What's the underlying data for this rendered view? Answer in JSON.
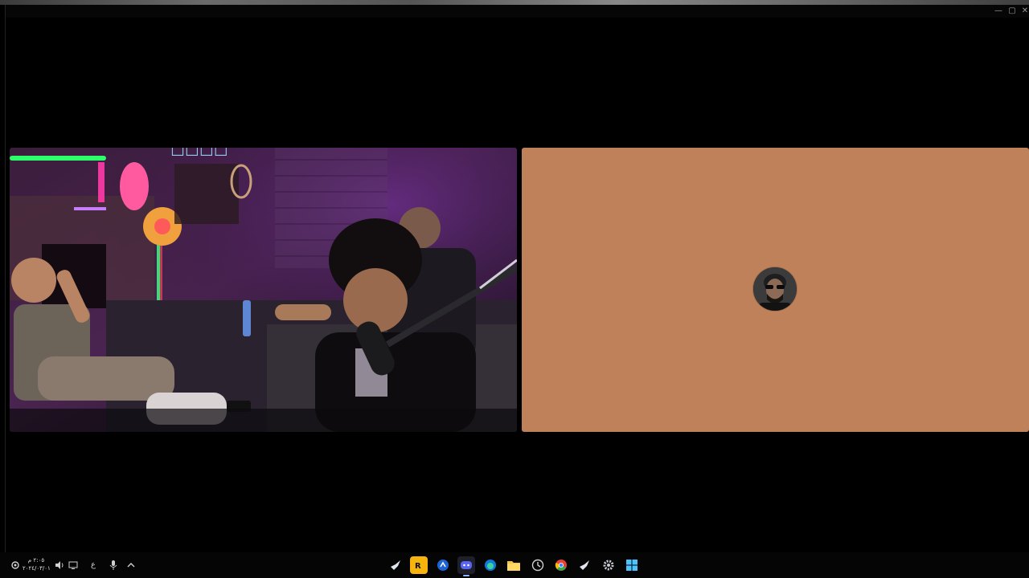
{
  "window": {
    "controls": {
      "minimize": "—",
      "maximize": "▢",
      "close": "✕"
    }
  },
  "participants": [
    {
      "type": "video"
    },
    {
      "type": "avatar",
      "tile_color": "#bf8159"
    }
  ],
  "taskbar": {
    "tray": {
      "keyboard_lang": "ع",
      "time": "٢:٠٥ م",
      "date": "٢٠٢٤/٠٣/٠١"
    },
    "apps": [
      "steam",
      "rockstar-launcher",
      "bing-visual-search",
      "discord",
      "edge",
      "file-explorer",
      "clock",
      "chrome",
      "steam",
      "settings",
      "start"
    ]
  }
}
